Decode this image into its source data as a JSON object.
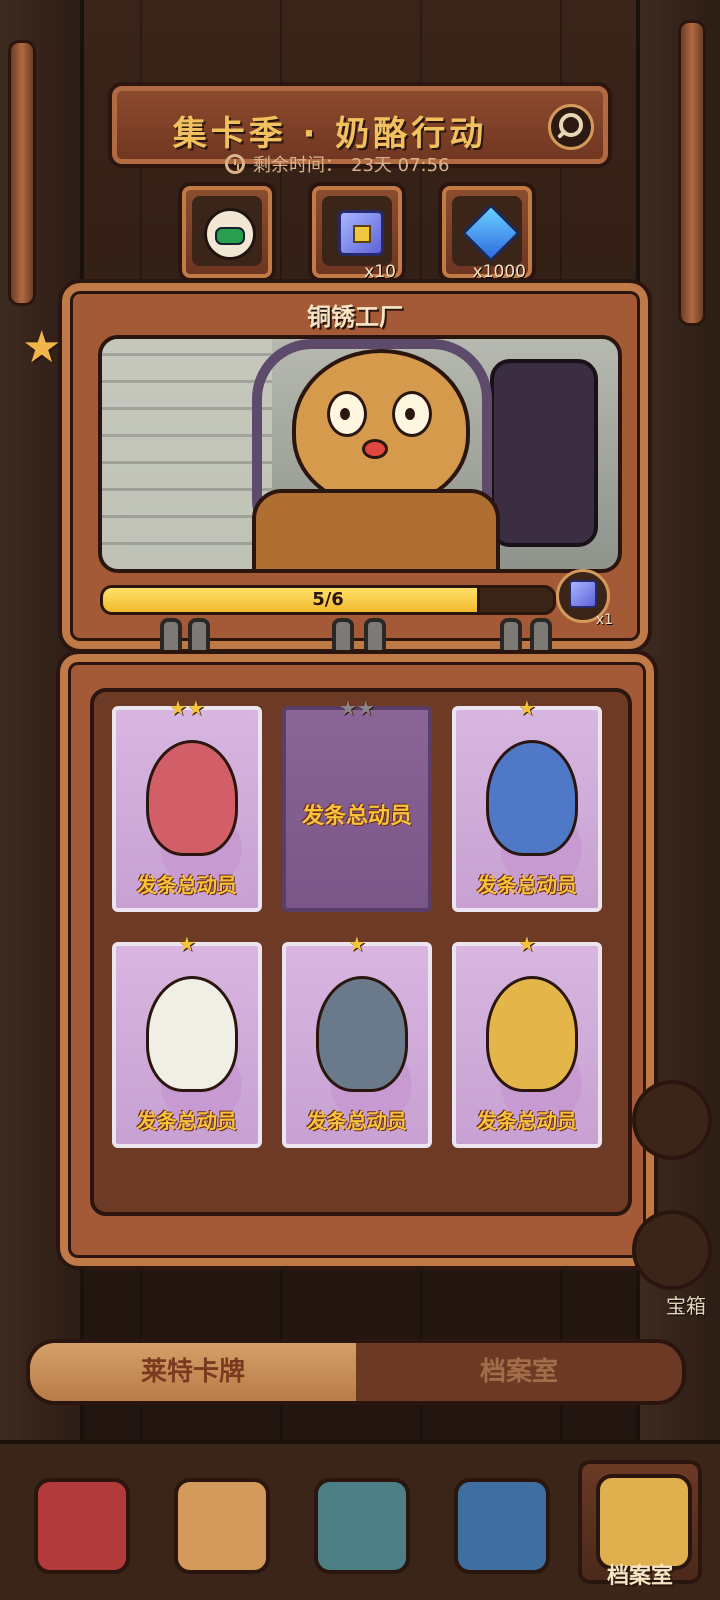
{
  "event": {
    "title": "集卡季 · 奶酪行动",
    "timer_label": "剩余时间：",
    "timer_value": "23天 07:56"
  },
  "rewards": [
    {
      "icon": "character-avatar-icon",
      "qty": ""
    },
    {
      "icon": "cube-crate-icon",
      "qty": "x10"
    },
    {
      "icon": "gem-icon",
      "qty": "x1000"
    }
  ],
  "album": {
    "name": "铜锈工厂",
    "progress_text": "5/6",
    "progress_fraction": 0.83,
    "completion_reward_qty": "x1"
  },
  "cards": [
    {
      "stars": "★★",
      "brand": "发条总动员",
      "collected": true,
      "color": "#d25e67"
    },
    {
      "stars": "★★",
      "brand": "发条总动员",
      "collected": false,
      "color": "#7a5788"
    },
    {
      "stars": "★",
      "brand": "发条总动员",
      "collected": true,
      "color": "#4f79c6"
    },
    {
      "stars": "★",
      "brand": "发条总动员",
      "collected": true,
      "color": "#f0efe6"
    },
    {
      "stars": "★",
      "brand": "发条总动员",
      "collected": true,
      "color": "#6b7a8a"
    },
    {
      "stars": "★",
      "brand": "发条总动员",
      "collected": true,
      "color": "#e4b548"
    }
  ],
  "tabs": {
    "active": "莱特卡牌",
    "inactive": "档案室"
  },
  "side": {
    "chest_label": "宝箱"
  },
  "nav": {
    "active_label": "档案室"
  }
}
